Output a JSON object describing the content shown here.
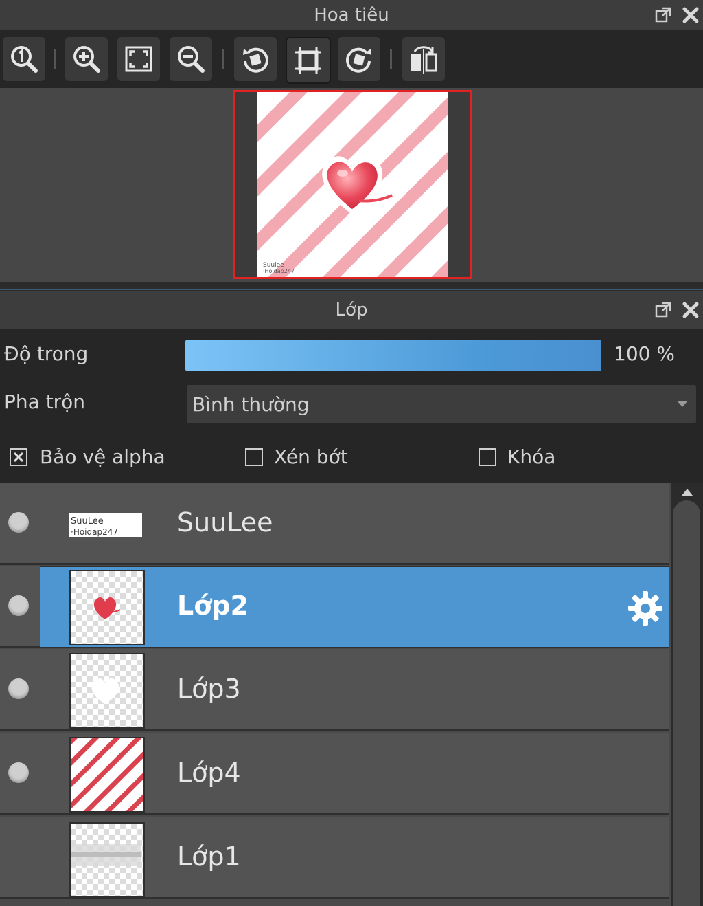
{
  "navigator": {
    "title": "Hoa tiêu",
    "toolbar": [
      {
        "icon": "zoom-actual-size-icon"
      },
      {
        "icon": "zoom-in-icon"
      },
      {
        "icon": "fit-to-window-icon"
      },
      {
        "icon": "zoom-out-icon"
      },
      {
        "icon": "rotate-left-icon"
      },
      {
        "icon": "fit-canvas-icon"
      },
      {
        "icon": "rotate-right-icon"
      },
      {
        "icon": "flip-horizontal-icon"
      }
    ]
  },
  "layers": {
    "title": "Lớp",
    "opacity_label": "Độ trong",
    "opacity_value": "100 %",
    "opacity_percent": 100,
    "blend_label": "Pha trộn",
    "blend_value": "Bình thường",
    "protect_alpha_label": "Bảo vệ alpha",
    "protect_alpha_checked": true,
    "clipping_label": "Xén bớt",
    "clipping_checked": false,
    "lock_label": "Khóa",
    "lock_checked": false,
    "items": [
      {
        "name": "SuuLee",
        "selected": false,
        "visible": true
      },
      {
        "name": "Lớp2",
        "selected": true,
        "visible": true
      },
      {
        "name": "Lớp3",
        "selected": false,
        "visible": true
      },
      {
        "name": "Lớp4",
        "selected": false,
        "visible": true
      },
      {
        "name": "Lớp1",
        "selected": false,
        "visible": false
      }
    ]
  },
  "colors": {
    "selection": "#4e96d2",
    "preview_border": "#e22222",
    "stripe": "#f2a9b1"
  }
}
